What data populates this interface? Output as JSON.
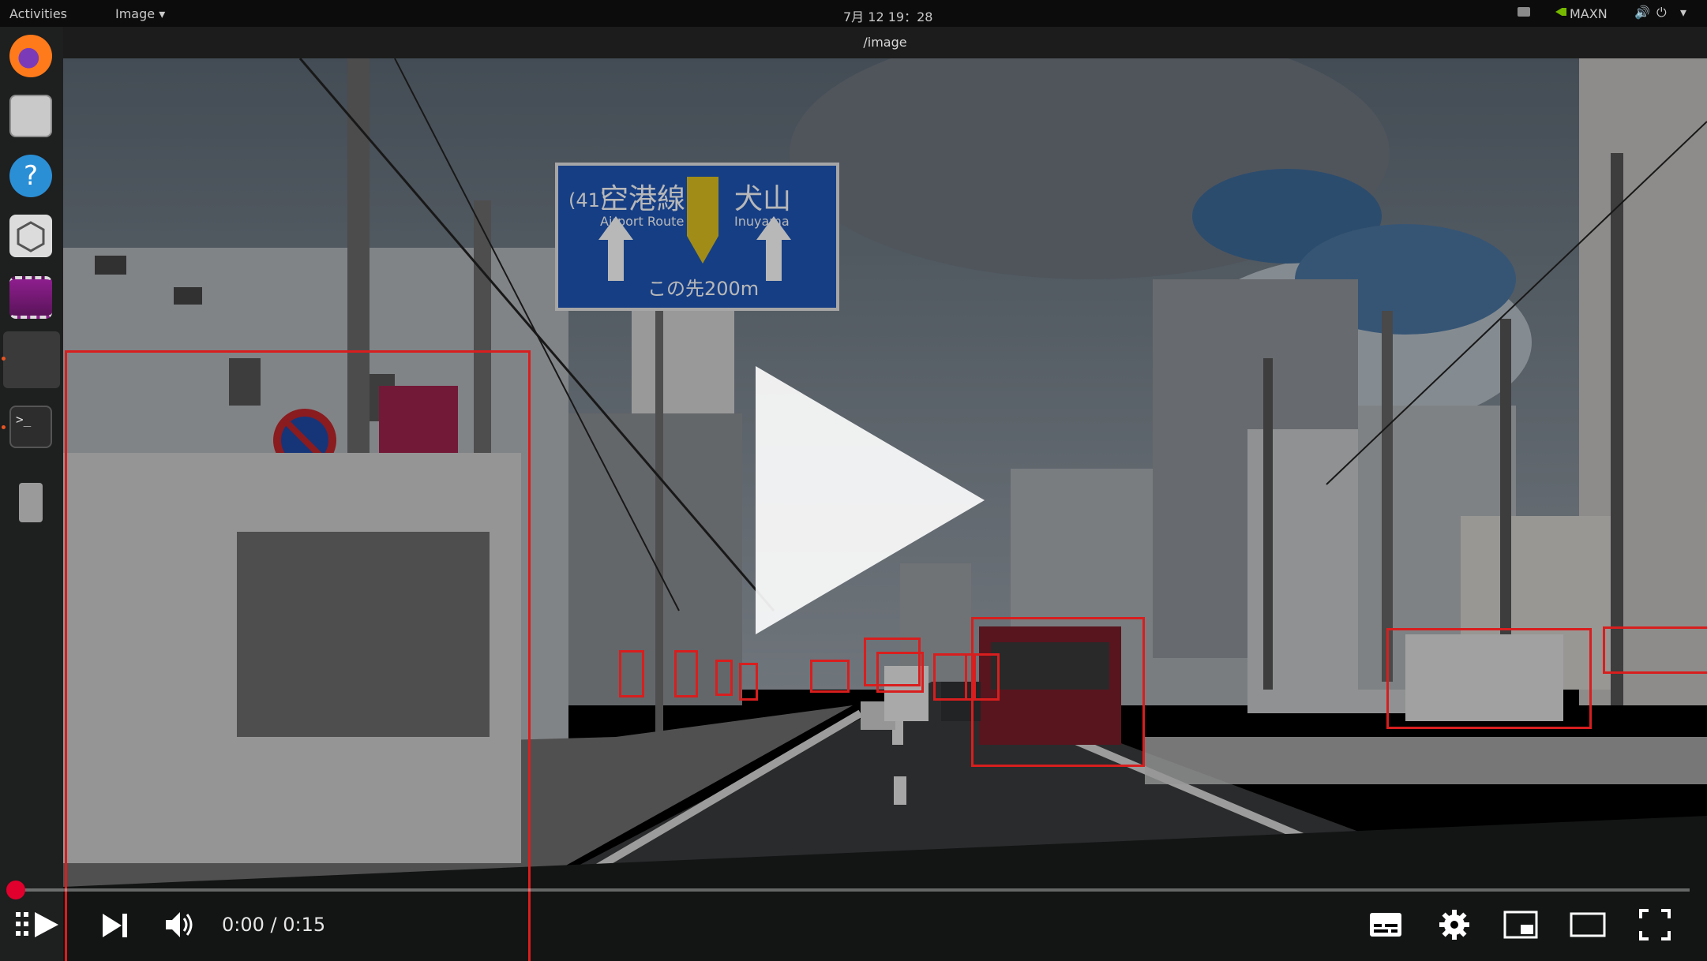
{
  "topbar": {
    "activities": "Activities",
    "app_menu": "Image ▾",
    "clock": "7月 12 19：28",
    "nvidia_mode": "MAXN"
  },
  "window": {
    "title": "/image"
  },
  "dock": {
    "icons": [
      "firefox-icon",
      "files-icon",
      "help-icon",
      "software-center-icon",
      "video-player-icon",
      "terminal-icon",
      "usb-drive-icon"
    ]
  },
  "sign": {
    "route_number": "41",
    "left_destination": "空港線",
    "left_romaji": "Airport Route",
    "right_destination": "犬山",
    "right_romaji": "Inuyama",
    "distance": "この先200m"
  },
  "video": {
    "time_display": "0:00 / 0:15",
    "progress": 0,
    "accent_color": "#e1002d"
  },
  "detections": {
    "box_color": "#d81e1e",
    "count": 13
  },
  "player_controls": [
    "play-button",
    "next-button",
    "volume-button",
    "subtitles-button",
    "settings-button",
    "miniplayer-button",
    "theater-mode-button",
    "fullscreen-button"
  ]
}
